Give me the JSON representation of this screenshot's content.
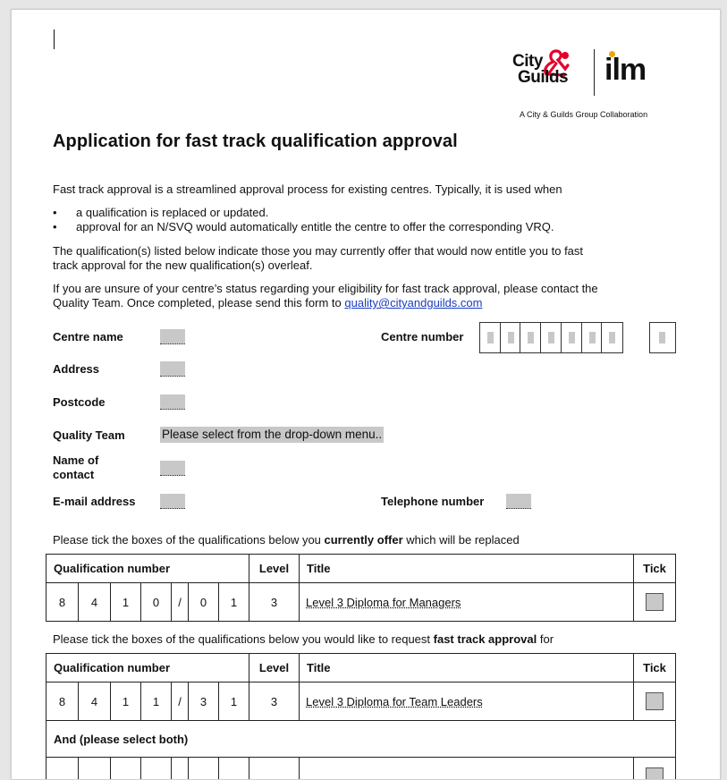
{
  "logo": {
    "city": "City",
    "guilds": "Guilds",
    "ilm": "ilm",
    "tagline": "A City & Guilds Group Collaboration"
  },
  "title": "Application for fast track qualification approval",
  "intro": "Fast track approval is a streamlined approval process for existing centres.  Typically, it is used when",
  "bullets": [
    "a qualification is replaced or updated.",
    "approval for an N/SVQ would automatically entitle the centre to offer the corresponding VRQ."
  ],
  "para2_line1": "The qualification(s) listed below indicate those you may currently offer that would now entitle you to fast",
  "para2_line2": "track approval for the new qualification(s) overleaf.",
  "para3_line1": "If you are unsure of your centre’s status regarding your eligibility for fast track approval, please contact the",
  "para3_line2_prefix": "Quality Team.  Once completed, please send this form to ",
  "email_link": "quality@cityandguilds.com",
  "form": {
    "centre_name_label": "Centre name",
    "centre_number_label": "Centre number",
    "address_label": "Address",
    "postcode_label": "Postcode",
    "quality_team_label": "Quality Team",
    "quality_team_value": "Please select from the drop-down menu..",
    "contact_label_1": "Name of",
    "contact_label_2": "contact",
    "email_label": "E-mail address",
    "telephone_label": "Telephone number"
  },
  "table1": {
    "instruction_prefix": "Please tick the boxes of the qualifications below you ",
    "instruction_bold": "currently offer",
    "instruction_suffix": " which will be replaced",
    "headers": {
      "qual": "Qualification number",
      "level": "Level",
      "title": "Title",
      "tick": "Tick"
    },
    "row": {
      "digits": [
        "8",
        "4",
        "1",
        "0",
        "/",
        "0",
        "1"
      ],
      "level": "3",
      "title": "Level 3 Diploma for Managers"
    }
  },
  "table2": {
    "instruction_prefix": "Please tick the boxes of the qualifications below you would like to request ",
    "instruction_bold": "fast track approval",
    "instruction_suffix": " for",
    "headers": {
      "qual": "Qualification number",
      "level": "Level",
      "title": "Title",
      "tick": "Tick"
    },
    "row": {
      "digits": [
        "8",
        "4",
        "1",
        "1",
        "/",
        "3",
        "1"
      ],
      "level": "3",
      "title": "Level 3 Diploma for Team Leaders"
    },
    "and_label": "And (please select both)"
  }
}
